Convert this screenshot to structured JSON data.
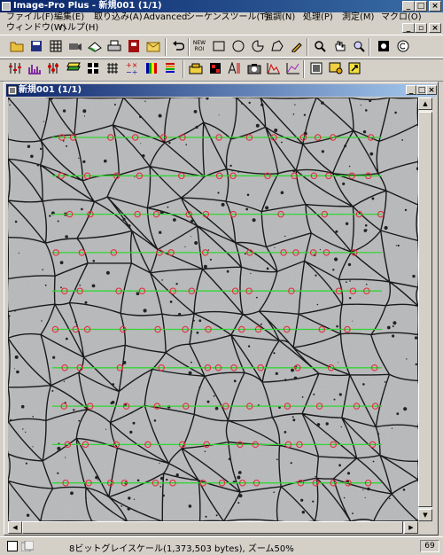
{
  "app": {
    "title": "Image-Pro Plus - 新規001 (1/1)"
  },
  "menu": [
    "ファイル(F)",
    "編集(E)",
    "取り込み(A)",
    "Advanced",
    "シーケンスツール(T)",
    "強調(N)",
    "処理(P)",
    "測定(M)",
    "マクロ(O)",
    "ウィンドウ(W)",
    "ヘルプ(H)"
  ],
  "toolbar": {
    "new_roi_label": "NEW ROI"
  },
  "document": {
    "title": "新規001 (1/1)"
  },
  "status": {
    "info": "8ビットグレイスケール(1,373,503 bytes), ズーム50%",
    "zoom_box": "69"
  },
  "colors": {
    "scan_line": "#33d633",
    "marker": "#e0303a",
    "title_bar": "#0a246a"
  }
}
